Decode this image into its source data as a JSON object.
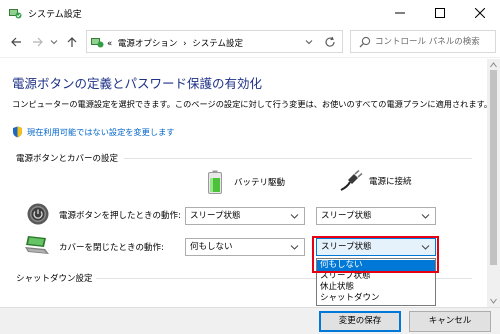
{
  "window": {
    "title": "システム設定",
    "app_icon": "control-panel-icon"
  },
  "address_bar": {
    "prefix": "«",
    "crumbs": [
      "電源オプション",
      "›",
      "システム設定"
    ],
    "search_placeholder": "コントロール パネルの検索"
  },
  "page": {
    "heading": "電源ボタンの定義とパスワード保護の有効化",
    "description": "コンピューターの電源設定を選択できます。このページの設定に対して行う変更は、お使いのすべての電源プランに適用されます。",
    "change_link": "現在利用可能ではない設定を変更します"
  },
  "power_section": {
    "title": "電源ボタンとカバーの設定",
    "col_battery": "バッテリ駆動",
    "col_plugged": "電源に接続",
    "rows": [
      {
        "label": "電源ボタンを押したときの動作:",
        "battery_value": "スリープ状態",
        "plugged_value": "スリープ状態"
      },
      {
        "label": "カバーを閉じたときの動作:",
        "battery_value": "何もしない",
        "plugged_value": "スリープ状態"
      }
    ]
  },
  "dropdown": {
    "options": [
      "何もしない",
      "スリープ状態",
      "休止状態",
      "シャットダウン"
    ],
    "selected_index": 0
  },
  "shutdown_section": {
    "title": "シャットダウン設定"
  },
  "footer": {
    "save_label": "変更の保存",
    "cancel_label": "キャンセル"
  },
  "colors": {
    "heading": "#1e3287",
    "link": "#0066cc",
    "selection": "#0078d7",
    "highlight_frame": "#e60012"
  }
}
